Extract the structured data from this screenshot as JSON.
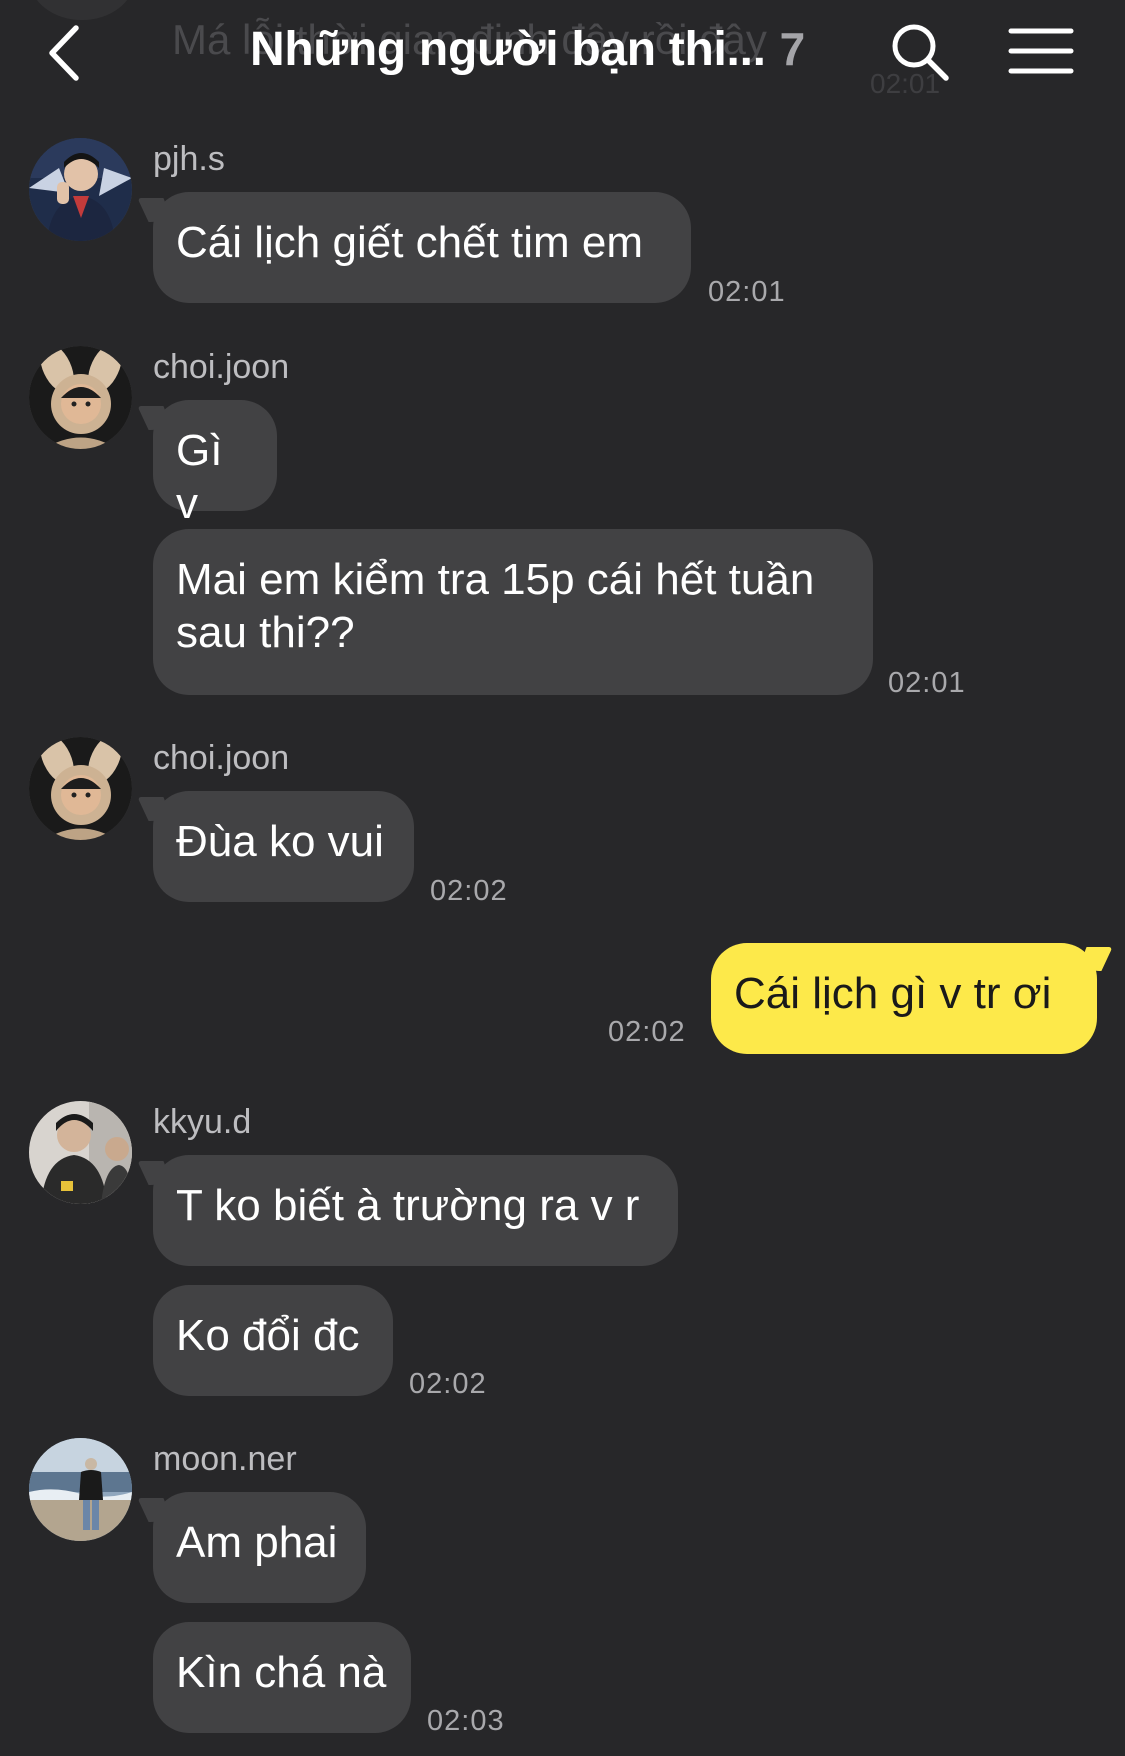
{
  "header": {
    "title": "Những người bạn thi...",
    "member_count": "7",
    "ghost_preview": "Má lỗi thời gian định đây rồi đây",
    "ghost_time": "02:01"
  },
  "messages": {
    "m1": {
      "sender": "pjh.s",
      "text": "Cái lịch giết chết tim em",
      "time": "02:01"
    },
    "m2": {
      "sender": "choi.joon",
      "text": "Gì v"
    },
    "m3": {
      "text_line1": "Mai em kiểm tra 15p cái hết tuần",
      "text_line2": "sau thi??",
      "time": "02:01"
    },
    "m4": {
      "sender": "choi.joon",
      "text": "Đùa ko vui",
      "time": "02:02"
    },
    "m5": {
      "text": "Cái lịch gì v tr ơi",
      "time": "02:02"
    },
    "m6": {
      "sender": "kkyu.d",
      "text": "T ko biết à trường ra v r"
    },
    "m7": {
      "text": "Ko đổi đc",
      "time": "02:02"
    },
    "m8": {
      "sender": "moon.ner",
      "text": "Am phai"
    },
    "m9": {
      "text": "Kìn chá nà",
      "time": "02:03"
    }
  },
  "colors": {
    "background": "#272729",
    "bubble_other": "#424244",
    "bubble_mine": "#fde94a",
    "timestamp": "#a9a9ac"
  },
  "icons": [
    "back-arrow-icon",
    "search-icon",
    "hamburger-menu-icon"
  ]
}
